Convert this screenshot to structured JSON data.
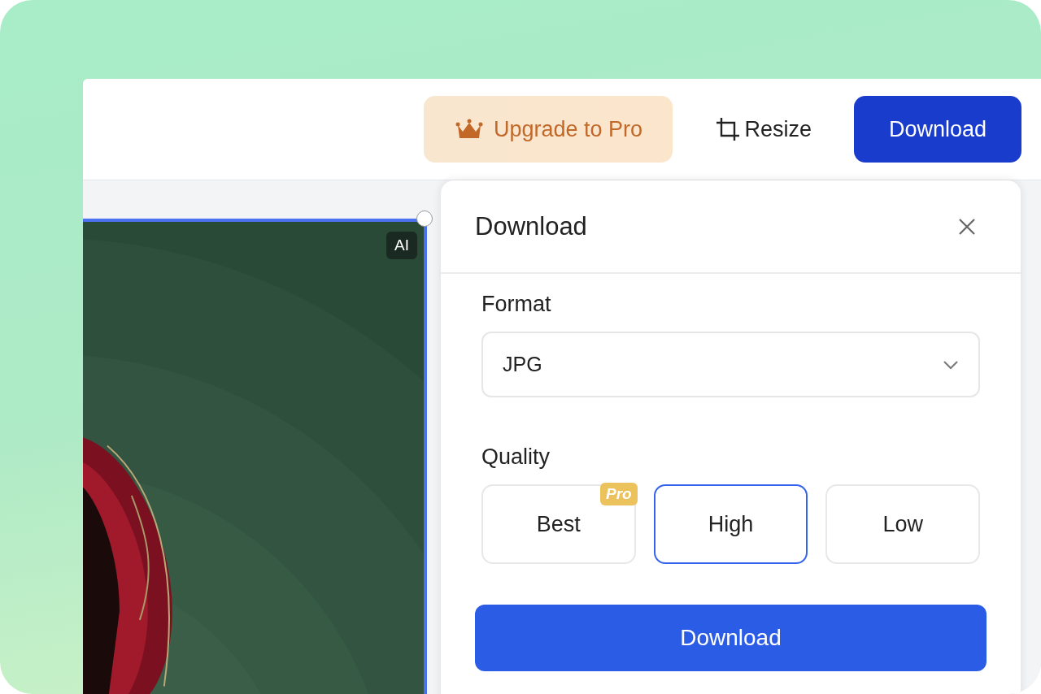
{
  "toolbar": {
    "buttons": [
      {
        "kind": "upgrade",
        "label": "Upgrade to Pro"
      },
      {
        "kind": "resize",
        "label": "Resize"
      },
      {
        "kind": "download",
        "label": "Download"
      }
    ]
  },
  "canvas": {
    "image": {
      "kind": "picture",
      "badge": "AI",
      "selected": true
    }
  },
  "panel": {
    "title": "Download",
    "format": {
      "label": "Format",
      "value": "JPG"
    },
    "quality": {
      "label": "Quality",
      "options": [
        {
          "label": "Best",
          "badge": "Pro",
          "selected": false
        },
        {
          "label": "High",
          "selected": true
        },
        {
          "label": "Low",
          "selected": false
        }
      ]
    },
    "action": "Download"
  }
}
